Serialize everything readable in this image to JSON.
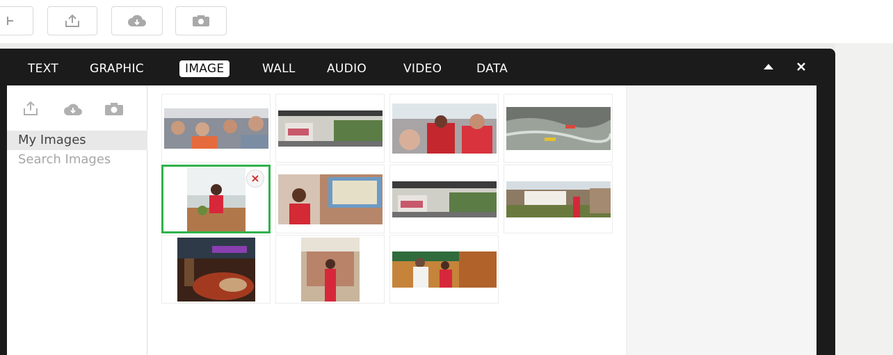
{
  "toolbar": {
    "buttons": [
      {
        "name": "partial-button",
        "icon": "split-icon"
      },
      {
        "name": "upload-button",
        "icon": "upload-icon"
      },
      {
        "name": "cloud-download-button",
        "icon": "cloud-download-icon"
      },
      {
        "name": "camera-button",
        "icon": "camera-icon"
      }
    ]
  },
  "dialog": {
    "tabs": [
      {
        "label": "TEXT"
      },
      {
        "label": "GRAPHIC"
      },
      {
        "label": "IMAGE"
      },
      {
        "label": "WALL"
      },
      {
        "label": "AUDIO"
      },
      {
        "label": "VIDEO"
      },
      {
        "label": "DATA"
      }
    ],
    "active_tab": "IMAGE",
    "controls": {
      "minimize_icon": "triangle-up-icon",
      "close_icon": "close-icon"
    }
  },
  "sidebar": {
    "icons": [
      "upload-icon",
      "cloud-download-icon",
      "camera-icon"
    ],
    "items": [
      {
        "label": "My Images",
        "selected": true
      },
      {
        "label": "Search Images",
        "selected": false
      }
    ]
  },
  "gallery": {
    "delete_glyph": "×",
    "images": [
      {
        "name": "group-selfie-car",
        "selected": false
      },
      {
        "name": "parking-area",
        "selected": false
      },
      {
        "name": "group-selfie-red",
        "selected": false
      },
      {
        "name": "river-rafting",
        "selected": false
      },
      {
        "name": "woman-red-dress-table",
        "selected": true
      },
      {
        "name": "woman-with-map",
        "selected": false
      },
      {
        "name": "parking-area-2",
        "selected": false
      },
      {
        "name": "school-sign",
        "selected": false
      },
      {
        "name": "casino-floor",
        "selected": false
      },
      {
        "name": "woman-red-poster",
        "selected": false
      },
      {
        "name": "couple-mural",
        "selected": false
      }
    ]
  },
  "colors": {
    "dialog_bg": "#1b1b1b",
    "selected_border": "#2fb24a",
    "delete_red": "#d12a2a"
  }
}
